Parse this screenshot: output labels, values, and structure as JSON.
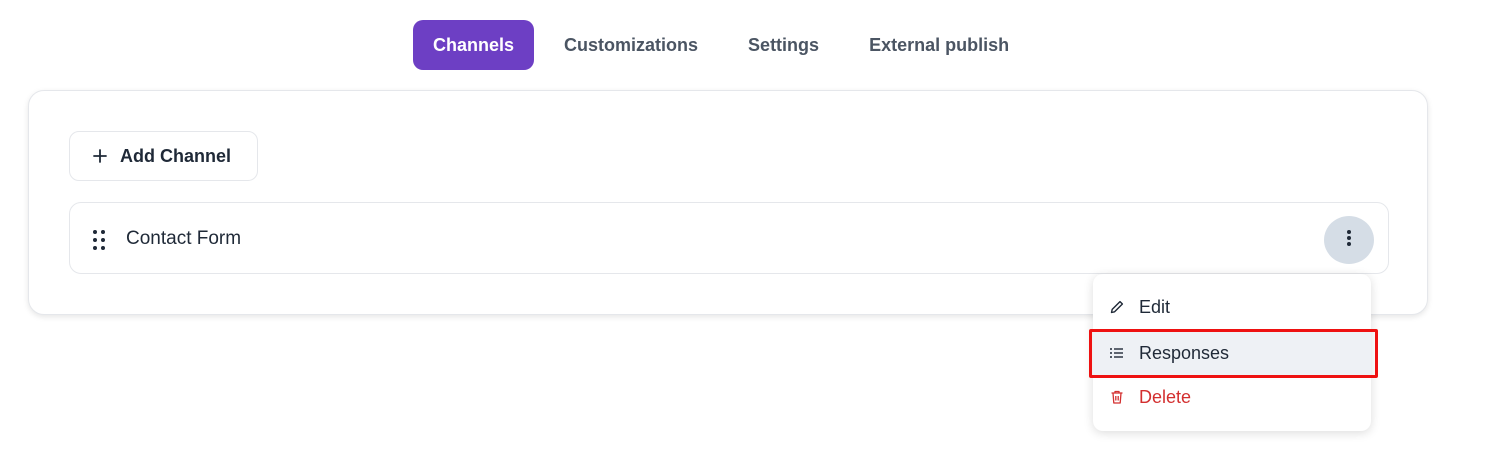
{
  "tabs": [
    {
      "label": "Channels",
      "active": true
    },
    {
      "label": "Customizations",
      "active": false
    },
    {
      "label": "Settings",
      "active": false
    },
    {
      "label": "External publish",
      "active": false
    }
  ],
  "card": {
    "add_button_label": "Add Channel",
    "channels": [
      {
        "name": "Contact Form"
      }
    ]
  },
  "menu": {
    "items": [
      {
        "label": "Edit",
        "icon": "pencil-icon"
      },
      {
        "label": "Responses",
        "icon": "list-icon",
        "highlighted": true
      },
      {
        "label": "Delete",
        "icon": "trash-icon",
        "color": "#d32f2f"
      }
    ]
  },
  "colors": {
    "accent": "#6d3fc4",
    "danger": "#d32f2f",
    "highlight_border": "#ee1111"
  }
}
